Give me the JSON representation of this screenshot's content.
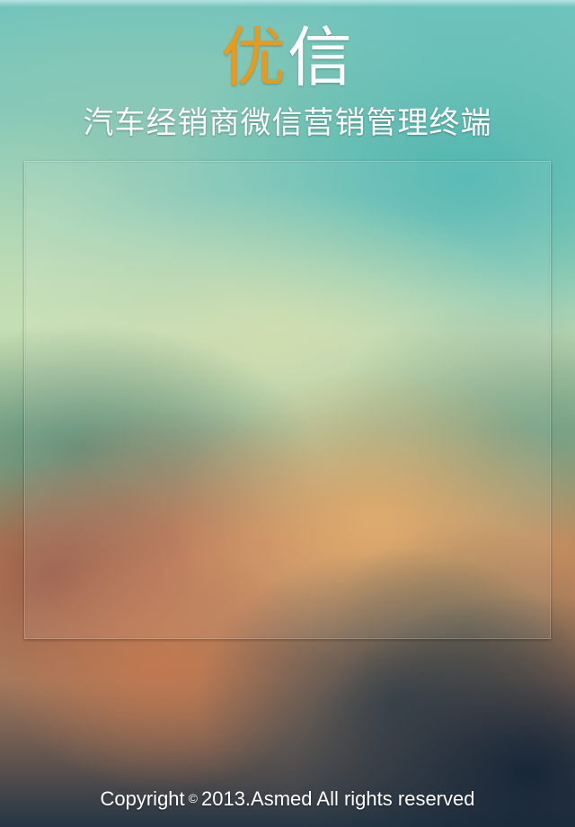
{
  "header": {
    "logo_part1": "优",
    "logo_part2": "信",
    "subtitle": "汽车经销商微信营销管理终端"
  },
  "panel": {},
  "footer": {
    "copyright_word": "Copyright",
    "copyright_symbol": "©",
    "copyright_text": "2013.Asmed All rights reserved"
  },
  "colors": {
    "logo_accent": "#e89a1c",
    "logo_secondary": "#ffffff",
    "text": "#ffffff"
  }
}
